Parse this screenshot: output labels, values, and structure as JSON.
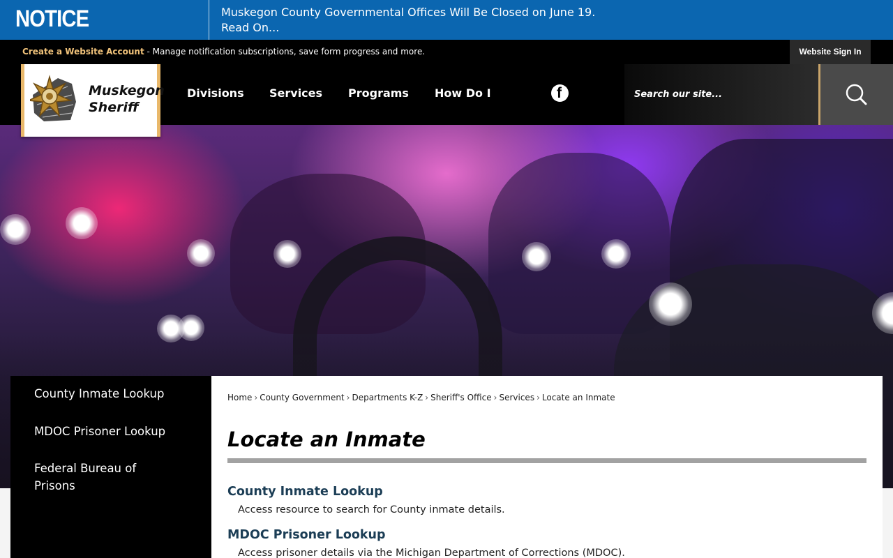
{
  "notice": {
    "label": "NOTICE",
    "message": "Muskegon County Governmental Offices Will Be Closed on June 19.",
    "read_on": "Read On..."
  },
  "account_bar": {
    "create_link": "Create a Website Account",
    "description": " - Manage notification subscriptions, save form progress and more.",
    "sign_in": "Website Sign In"
  },
  "header": {
    "logo_line1": "Muskegon",
    "logo_line2": "Sheriff",
    "nav": [
      "Divisions",
      "Services",
      "Programs",
      "How Do I"
    ],
    "social_icon": "facebook-icon",
    "search_placeholder": "Search our site...",
    "search_icon": "search-icon"
  },
  "sidebar": {
    "items": [
      {
        "label": "County Inmate Lookup"
      },
      {
        "label": "MDOC Prisoner Lookup"
      },
      {
        "label": "Federal Bureau of Prisons"
      }
    ]
  },
  "breadcrumb": [
    "Home",
    "County Government",
    "Departments K-Z",
    "Sheriff's Office",
    "Services",
    "Locate an Inmate"
  ],
  "main": {
    "title": "Locate an Inmate",
    "items": [
      {
        "title": "County Inmate Lookup",
        "description": "Access resource to search for County inmate details."
      },
      {
        "title": "MDOC Prisoner Lookup",
        "description": "Access prisoner details via the Michigan Department of Corrections (MDOC)."
      }
    ]
  },
  "colors": {
    "notice_bg": "#0b66b0",
    "header_bg": "#000000",
    "accent_gold": "#e9b86a",
    "link_title": "#1b3d55"
  }
}
